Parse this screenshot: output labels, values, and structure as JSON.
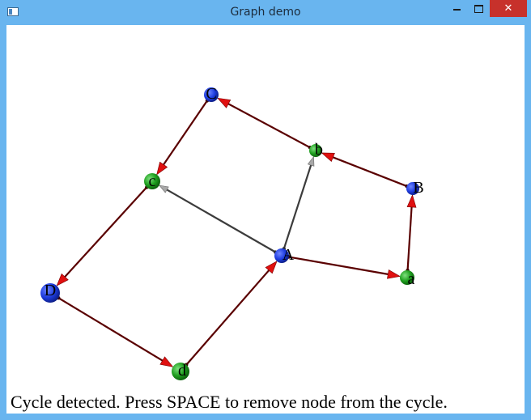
{
  "window": {
    "title": "Graph demo",
    "close_glyph": "✕"
  },
  "graph": {
    "nodes": [
      {
        "id": "C",
        "label": "C",
        "color": "blue"
      },
      {
        "id": "b",
        "label": "b",
        "color": "green"
      },
      {
        "id": "B",
        "label": "B",
        "color": "blue"
      },
      {
        "id": "c",
        "label": "c",
        "color": "green"
      },
      {
        "id": "A",
        "label": "A",
        "color": "blue"
      },
      {
        "id": "a",
        "label": "a",
        "color": "green"
      },
      {
        "id": "D",
        "label": "D",
        "color": "blue"
      },
      {
        "id": "d",
        "label": "d",
        "color": "green"
      }
    ],
    "edges": [
      {
        "from": "A",
        "to": "a",
        "style": "cycle"
      },
      {
        "from": "a",
        "to": "B",
        "style": "cycle"
      },
      {
        "from": "B",
        "to": "b",
        "style": "cycle"
      },
      {
        "from": "b",
        "to": "C",
        "style": "cycle"
      },
      {
        "from": "C",
        "to": "c",
        "style": "cycle"
      },
      {
        "from": "c",
        "to": "D",
        "style": "cycle"
      },
      {
        "from": "D",
        "to": "d",
        "style": "cycle"
      },
      {
        "from": "d",
        "to": "A",
        "style": "cycle"
      },
      {
        "from": "A",
        "to": "b",
        "style": "normal"
      },
      {
        "from": "A",
        "to": "c",
        "style": "normal"
      }
    ],
    "colors": {
      "blue": "#1f3de0",
      "green": "#1fa01f",
      "cycle_edge": "#5a0000",
      "cycle_head": "#e01010",
      "normal_edge": "#3c3c3c",
      "normal_head": "#a8a8a8"
    }
  },
  "status": {
    "message": "Cycle detected. Press SPACE to remove node from the cycle."
  }
}
